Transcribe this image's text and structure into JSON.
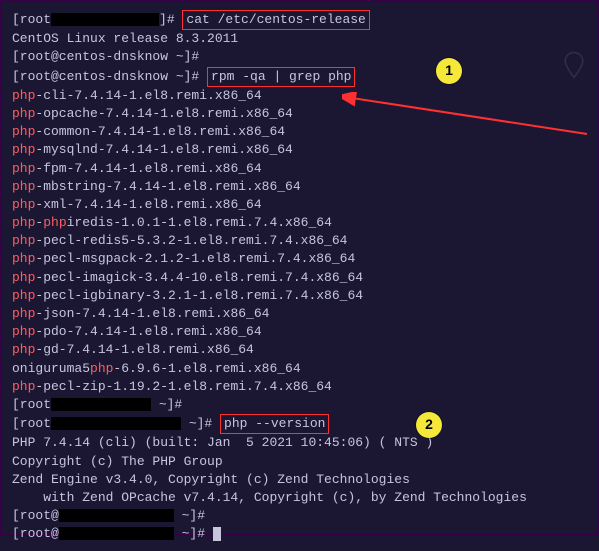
{
  "line1": {
    "prefix": "[root",
    "host_suffix": "]# ",
    "cmd": "cat /etc/centos-release"
  },
  "line2": "CentOS Linux release 8.3.2011",
  "line3": "[root@centos-dnsknow ~]#",
  "line4": {
    "prompt": "[root@centos-dnsknow ~]# ",
    "cmd": "rpm -qa | grep php"
  },
  "pkg": [
    {
      "p": "php",
      "s": "-cli-7.4.14-1.el8.remi.x86_64"
    },
    {
      "p": "php",
      "s": "-opcache-7.4.14-1.el8.remi.x86_64"
    },
    {
      "p": "php",
      "s": "-common-7.4.14-1.el8.remi.x86_64"
    },
    {
      "p": "php",
      "s": "-mysqlnd-7.4.14-1.el8.remi.x86_64"
    },
    {
      "p": "php",
      "s": "-fpm-7.4.14-1.el8.remi.x86_64"
    },
    {
      "p": "php",
      "s": "-mbstring-7.4.14-1.el8.remi.x86_64"
    },
    {
      "p": "php",
      "s": "-xml-7.4.14-1.el8.remi.x86_64"
    }
  ],
  "pkg_split": {
    "p1": "php",
    "p2": "-",
    "p3": "php",
    "p4": "iredis-1.0.1-1.el8.remi.7.4.x86_64"
  },
  "pkg2": [
    {
      "p": "php",
      "s": "-pecl-redis5-5.3.2-1.el8.remi.7.4.x86_64"
    },
    {
      "p": "php",
      "s": "-pecl-msgpack-2.1.2-1.el8.remi.7.4.x86_64"
    },
    {
      "p": "php",
      "s": "-pecl-imagick-3.4.4-10.el8.remi.7.4.x86_64"
    },
    {
      "p": "php",
      "s": "-pecl-igbinary-3.2.1-1.el8.remi.7.4.x86_64"
    },
    {
      "p": "php",
      "s": "-json-7.4.14-1.el8.remi.x86_64"
    },
    {
      "p": "php",
      "s": "-pdo-7.4.14-1.el8.remi.x86_64"
    },
    {
      "p": "php",
      "s": "-gd-7.4.14-1.el8.remi.x86_64"
    }
  ],
  "onig": {
    "pre": "oniguruma5",
    "mid": "php",
    "suf": "-6.9.6-1.el8.remi.x86_64"
  },
  "pkg3": {
    "p": "php",
    "s": "-pecl-zip-1.19.2-1.el8.remi.7.4.x86_64"
  },
  "prompt_end1": {
    "pre": "[root",
    "suf": " ~]#"
  },
  "prompt_end2": {
    "pre": "[root",
    "suf": " ~]# ",
    "cmd": "php --version"
  },
  "ver1": "PHP 7.4.14 (cli) (built: Jan  5 2021 10:45:06) ( NTS )",
  "ver2": "Copyright (c) The PHP Group",
  "ver3": "Zend Engine v3.4.0, Copyright (c) Zend Technologies",
  "ver4": "    with Zend OPcache v7.4.14, Copyright (c), by Zend Technologies",
  "prompt_final1": {
    "pre": "[root@",
    "suf": " ~]#"
  },
  "prompt_final2": {
    "pre": "[root@",
    "suf": " ~]# "
  },
  "marker1": "1",
  "marker2": "2"
}
